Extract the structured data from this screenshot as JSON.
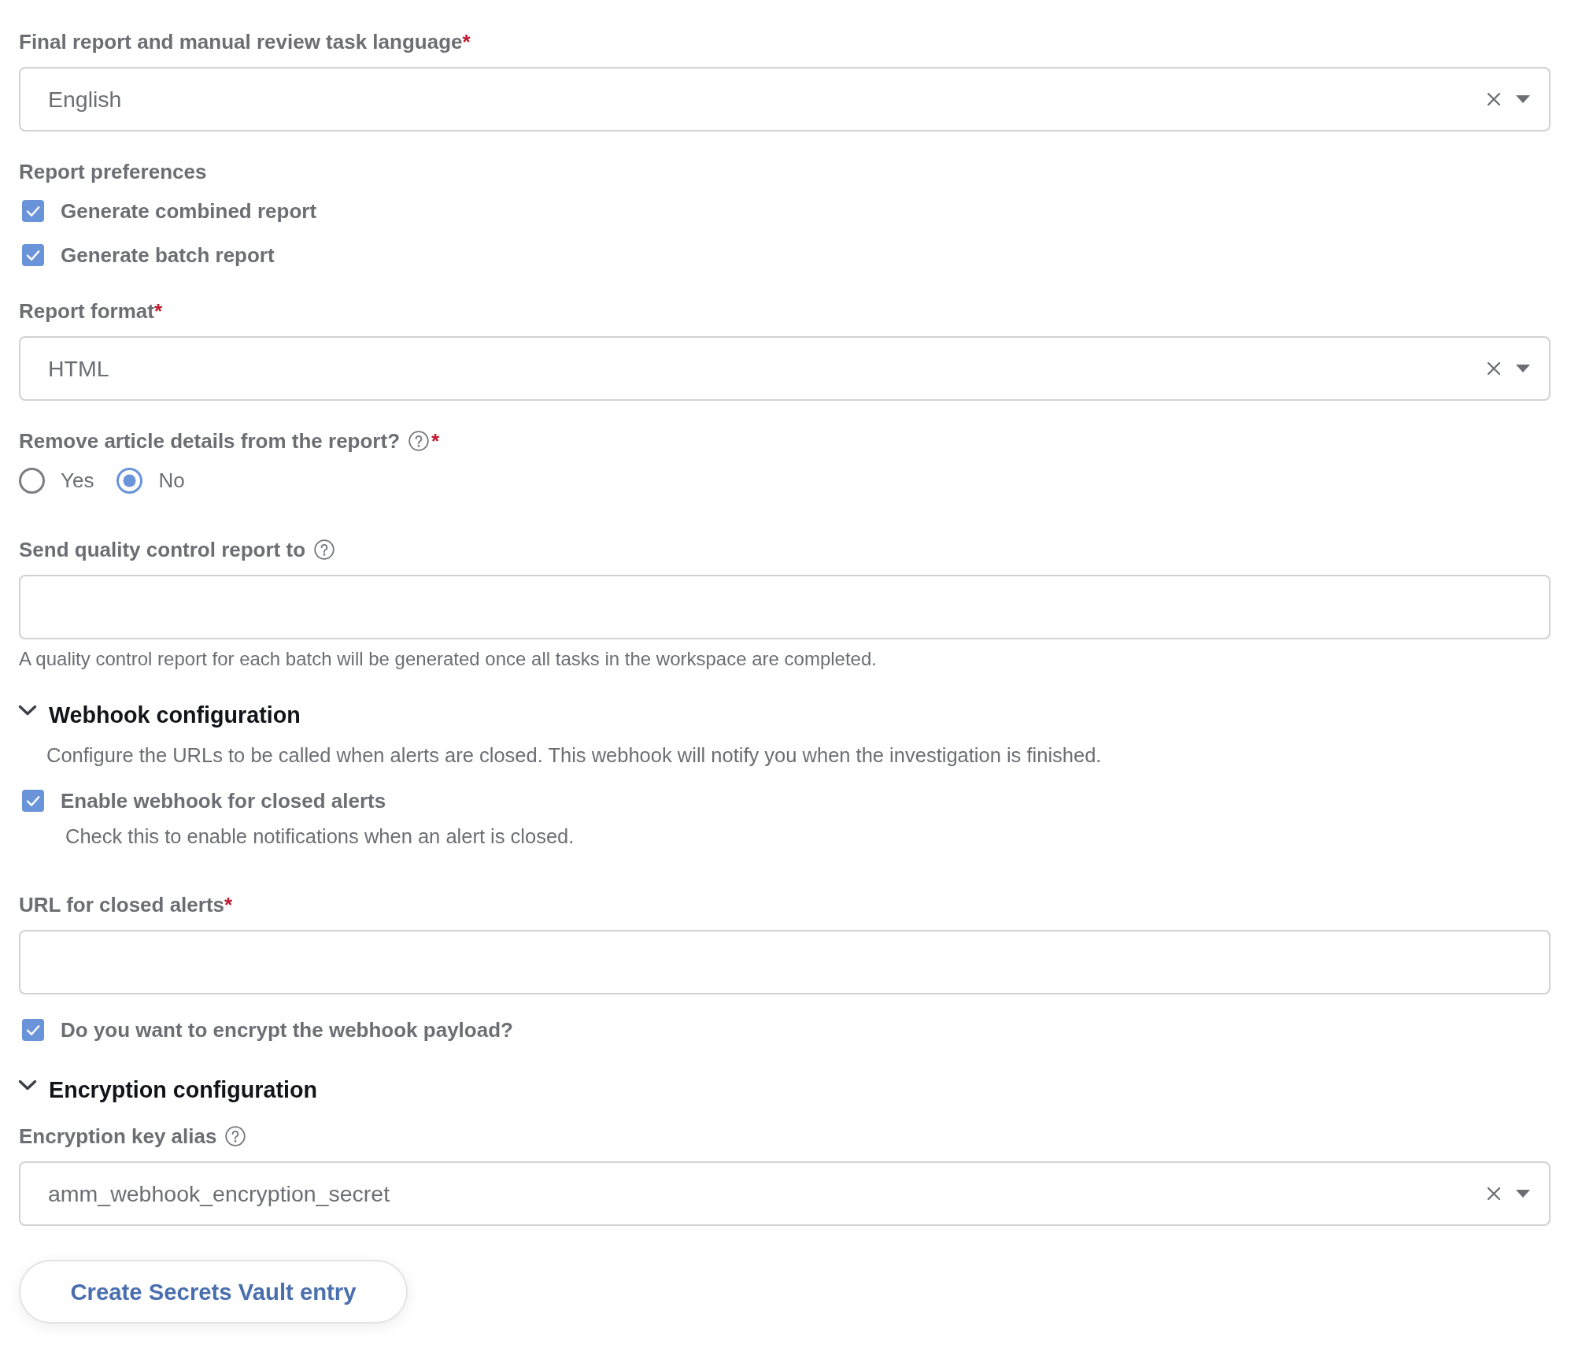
{
  "form": [
    {
      "kind": "select",
      "label": "Final report and manual review task language",
      "required_mark": "*",
      "value": "English",
      "clearable": true
    },
    {
      "kind": "checkbox_group",
      "label": "Report preferences",
      "options": [
        {
          "label": "Generate combined report",
          "checked": true
        },
        {
          "label": "Generate batch report",
          "checked": true
        }
      ]
    },
    {
      "kind": "select",
      "label": "Report format",
      "required_mark": "*",
      "value": "HTML",
      "clearable": true
    },
    {
      "kind": "radio_group",
      "label": "Remove article details from the report?",
      "help_icon": true,
      "required_mark": "*",
      "options": [
        {
          "label": "Yes",
          "selected": false
        },
        {
          "label": "No",
          "selected": true
        }
      ]
    },
    {
      "kind": "text_input",
      "label": "Send quality control report to",
      "help_icon": true,
      "help_text": "A quality control report for each batch will be generated once all tasks in the workspace are completed."
    },
    {
      "kind": "section",
      "title": "Webhook configuration",
      "expanded": true,
      "description": "Configure the URLs to be called when alerts are closed. This webhook will notify you when the investigation is finished."
    },
    {
      "kind": "checkbox",
      "label": "Enable webhook for closed alerts",
      "checked": true,
      "description": "Check this to enable notifications when an alert is closed."
    },
    {
      "kind": "text_input",
      "label": "URL for closed alerts",
      "required_mark": "*"
    },
    {
      "kind": "checkbox",
      "label": "Do you want to encrypt the webhook payload?",
      "checked": true
    },
    {
      "kind": "section",
      "title": "Encryption configuration",
      "expanded": true
    },
    {
      "kind": "select",
      "label": "Encryption key alias",
      "help_icon": true,
      "value": "amm_webhook_encryption_secret",
      "clearable": true
    },
    {
      "kind": "button",
      "label": "Create Secrets Vault entry"
    }
  ]
}
